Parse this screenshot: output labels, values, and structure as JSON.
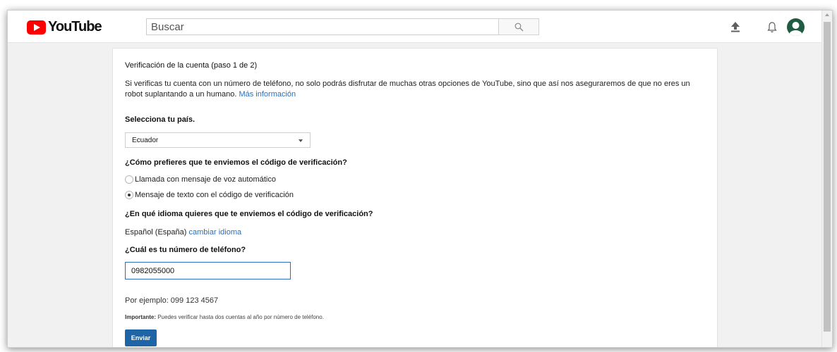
{
  "header": {
    "logo_text": "YouTube",
    "search_placeholder": "Buscar",
    "icons": [
      "search-icon",
      "upload-icon",
      "bell-icon",
      "avatar"
    ]
  },
  "form": {
    "title": "Verificación de la cuenta (paso 1 de 2)",
    "description": "Si verificas tu cuenta con un número de teléfono, no solo podrás disfrutar de muchas otras opciones de YouTube, sino que así nos aseguraremos de que no eres un robot suplantando a un humano. ",
    "more_info_link": "Más información",
    "country_label": "Selecciona tu país.",
    "country_value": "Ecuador",
    "method_label": "¿Cómo prefieres que te enviemos el código de verificación?",
    "method_options": [
      {
        "label": "Llamada con mensaje de voz automático",
        "checked": false
      },
      {
        "label": "Mensaje de texto con el código de verificación",
        "checked": true
      }
    ],
    "language_label": "¿En qué idioma quieres que te enviemos el código de verificación?",
    "language_value": "Español (España)",
    "change_language_link": "cambiar idioma",
    "phone_label": "¿Cuál es tu número de teléfono?",
    "phone_value": "0982055000",
    "example_text": "Por ejemplo: 099 123 4567",
    "note_strong": "Importante:",
    "note_text": " Puedes verificar hasta dos cuentas al año por número de teléfono.",
    "submit_label": "Enviar"
  },
  "colors": {
    "brand_red": "#ff0000",
    "link_blue": "#2a6fbf",
    "button_blue": "#1e65a8",
    "avatar_green": "#1f5c43"
  }
}
